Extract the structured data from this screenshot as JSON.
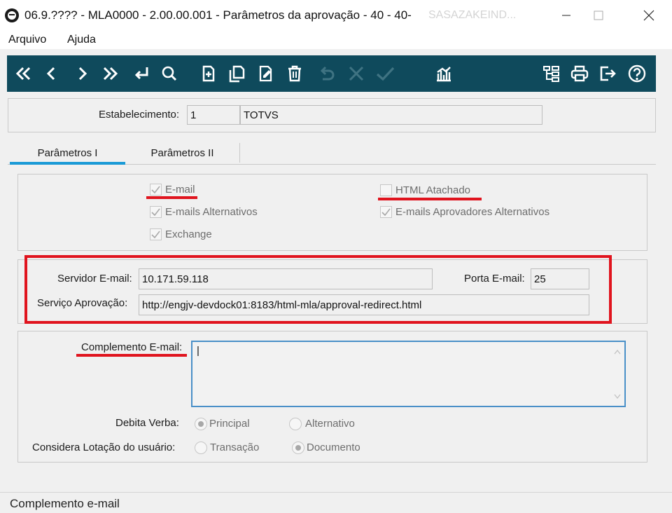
{
  "window": {
    "title": "06.9.???? - MLA0000 - 2.00.00.001 - Parâmetros da aprovação - 40 - 40-",
    "title_overflow": "SASAZAKEIND..."
  },
  "menu": {
    "items": [
      "Arquivo",
      "Ajuda"
    ]
  },
  "toolbar": {
    "left_icons": [
      "first-icon",
      "previous-icon",
      "next-icon",
      "last-icon",
      "goto-icon",
      "search-icon",
      "new-icon",
      "copy-icon",
      "edit-icon",
      "delete-icon",
      "undo-icon",
      "cancel-icon",
      "confirm-icon",
      "report-icon"
    ],
    "right_icons": [
      "tree-icon",
      "print-icon",
      "exit-icon",
      "help-icon"
    ]
  },
  "header": {
    "estabelecimento_label": "Estabelecimento:",
    "estabelecimento_code": "1",
    "estabelecimento_name": "TOTVS"
  },
  "tabs": [
    {
      "label": "Parâmetros I",
      "active": true
    },
    {
      "label": "Parâmetros II",
      "active": false
    }
  ],
  "checkboxes": {
    "email": {
      "label": "E-mail",
      "checked": true
    },
    "emails_alternativos": {
      "label": "E-mails Alternativos",
      "checked": true
    },
    "exchange": {
      "label": "Exchange",
      "checked": true
    },
    "html_atachado": {
      "label": "HTML Atachado",
      "checked": false
    },
    "emails_aprovadores": {
      "label": "E-mails Aprovadores Alternativos",
      "checked": true
    }
  },
  "server": {
    "servidor_label": "Servidor E-mail:",
    "servidor_value": "10.171.59.118",
    "porta_label": "Porta E-mail:",
    "porta_value": "25",
    "servico_label": "Serviço Aprovação:",
    "servico_value": "http://engjv-devdock01:8183/html-mla/approval-redirect.html"
  },
  "complemento": {
    "label": "Complemento E-mail:",
    "value": "|"
  },
  "debita_verba": {
    "label": "Debita Verba:",
    "options": [
      "Principal",
      "Alternativo"
    ],
    "selected": "Principal"
  },
  "considera_lotacao": {
    "label": "Considera Lotação do usuário:",
    "options": [
      "Transação",
      "Documento"
    ],
    "selected": "Documento"
  },
  "status_bar": {
    "text": "Complemento e-mail"
  },
  "colors": {
    "toolbar_bg": "#0f4a5c",
    "highlight_red": "#e0141e",
    "tab_active_blue": "#1a9ad6",
    "focus_border": "#4a90c8"
  }
}
